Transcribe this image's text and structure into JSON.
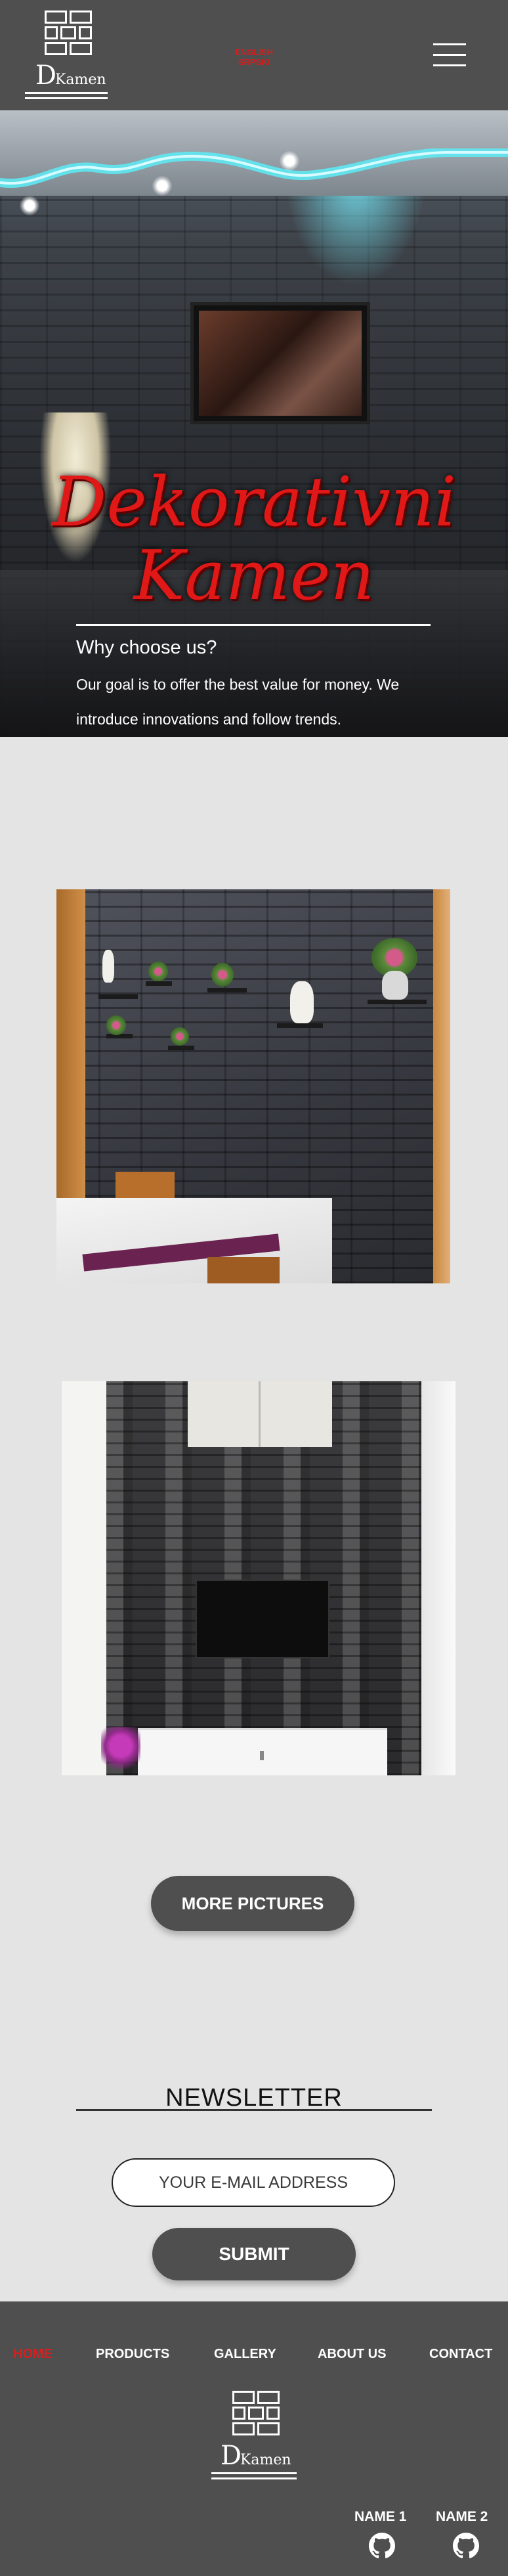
{
  "header": {
    "logo_letter": "D",
    "logo_name": "Kamen",
    "language_selector": [
      "ENGLISH",
      "SRPSKI"
    ],
    "menu_icon": "hamburger-menu-icon"
  },
  "hero": {
    "title_line1": "Dekorativni",
    "title_line2": "Kamen",
    "subtitle": "Why choose us?",
    "text": "Our goal is to offer the best value for money. We introduce innovations and follow trends.",
    "title_color": "#e01818"
  },
  "gallery": {
    "more_button": "MORE PICTURES"
  },
  "newsletter": {
    "title": "NEWSLETTER",
    "email_placeholder": "YOUR E-MAIL ADDRESS",
    "submit_button": "SUBMIT"
  },
  "footer": {
    "nav": [
      "HOME",
      "PRODUCTS",
      "GALLERY",
      "ABOUT US",
      "CONTACT"
    ],
    "active_nav": "HOME",
    "logo_letter": "D",
    "logo_name": "Kamen",
    "names": [
      "NAME 1",
      "NAME 2"
    ],
    "name_icon": "github-icon"
  },
  "colors": {
    "header_bg": "#4f4f4f",
    "page_bg": "#e4e4e4",
    "accent_red": "#d42020"
  }
}
